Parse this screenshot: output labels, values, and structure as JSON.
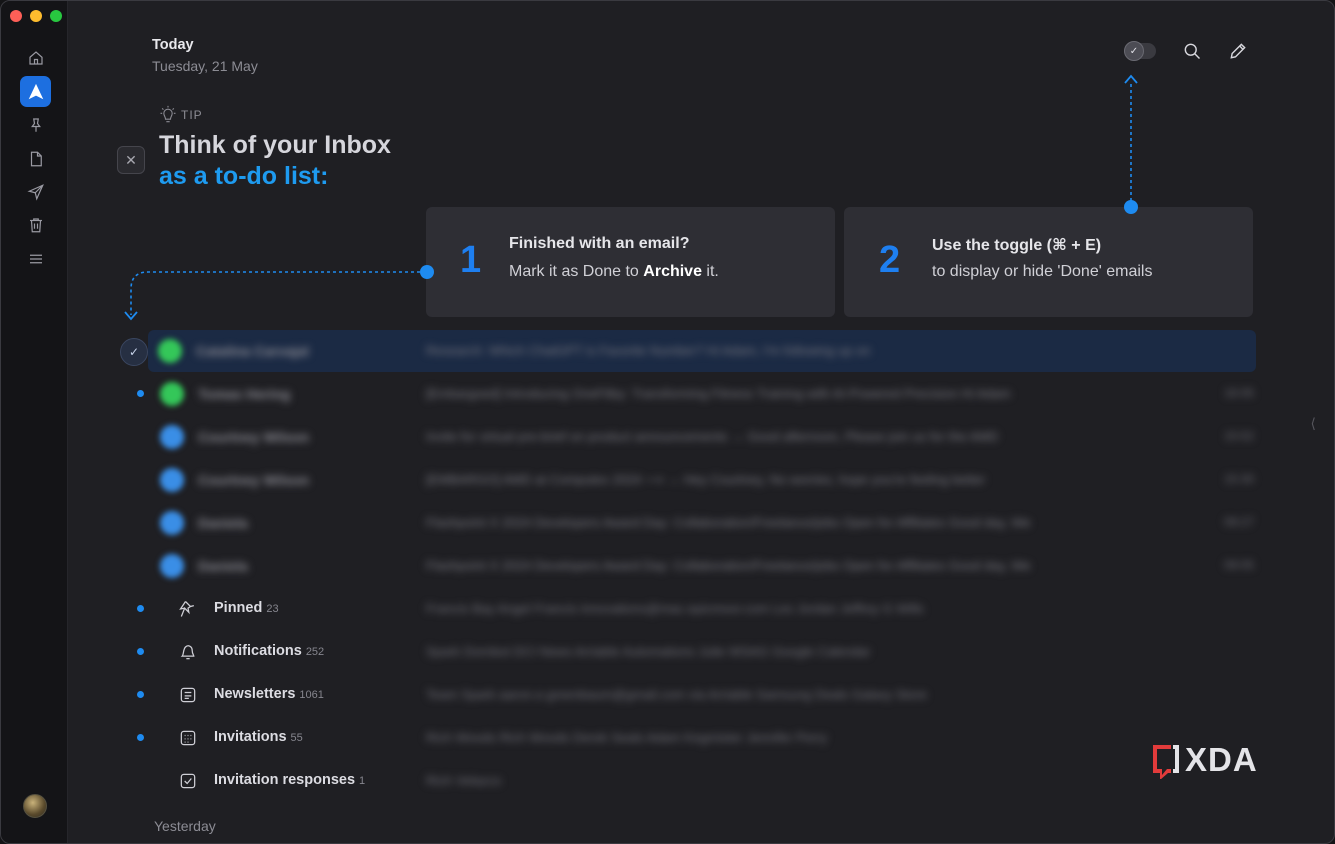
{
  "header": {
    "title": "Today",
    "date": "Tuesday, 21 May"
  },
  "toolbar": {
    "toggle_checkmark": "✓",
    "search_icon": "search-icon",
    "compose_icon": "pencil-icon"
  },
  "tip": {
    "label": "TIP",
    "title_line1": "Think of your Inbox",
    "title_line2": "as a to-do list:",
    "close_symbol": "✕"
  },
  "cards": [
    {
      "number": "1",
      "heading": "Finished with an email?",
      "body_prefix": "Mark it as Done to ",
      "body_bold": "Archive",
      "body_suffix": " it."
    },
    {
      "number": "2",
      "heading": "Use the toggle (⌘ + E)",
      "body": "to display or hide 'Done' emails"
    }
  ],
  "emails": [
    {
      "sender": "Catalina Carvajal",
      "subject": "Research: Which ChatGPT is Favorite Number?  Hi Adam, I'm following up on",
      "time": "",
      "color": "#34c759",
      "unread": false,
      "selected": true
    },
    {
      "sender": "Tomas Hering",
      "subject": "[Embargoed] Introducing OneFitby: Transforming Fitness Training with AI-Powered Precision  Hi Adam",
      "time": "16:05",
      "color": "#34c759",
      "unread": true,
      "selected": false
    },
    {
      "sender": "Courtney Wilson",
      "subject": "Invite for virtual pre-brief on product announcements  →  Good afternoon, Please join us for the AMD",
      "time": "15:52",
      "color": "#3a8ee6",
      "unread": false,
      "selected": false
    },
    {
      "sender": "Courtney Wilson",
      "subject": "[EMBARGO] AMD at Computex 2024  ⟶  →  Hey Courtney, No worries, hope you're feeling better",
      "time": "15:30",
      "color": "#3a8ee6",
      "unread": false,
      "selected": false
    },
    {
      "sender": "Daniela",
      "subject": "Flashpoint X 2024 Developers Award Day: Collaboration/Freelance/jobs Open for Affiliates  Good day, We",
      "time": "09:27",
      "color": "#3a8ee6",
      "unread": false,
      "selected": false
    },
    {
      "sender": "Daniela",
      "subject": "Flashpoint X 2024 Developers Award Day: Collaboration/Freelance/jobs Open for Affiliates  Good day, We",
      "time": "09:05",
      "color": "#3a8ee6",
      "unread": false,
      "selected": false
    }
  ],
  "categories": [
    {
      "label": "Pinned",
      "count": "23",
      "icon": "pin-icon",
      "preview": "Francis Bay   Angel Francis   innovations@mac.epicmoor.com   Les Jordan   Jeffrey G Wills",
      "unread": true
    },
    {
      "label": "Notifications",
      "count": "252",
      "icon": "bell-icon",
      "preview": "Spark   Dornbot   DCI News   Arriable Automations   Julie WSAG   Google Calendar",
      "unread": true
    },
    {
      "label": "Newsletters",
      "count": "1061",
      "icon": "newspaper-icon",
      "preview": "Team Spark   aaron.e.greenbaum@gmail.com via Arriable   Samsung Deals   Galaxy Store",
      "unread": true
    },
    {
      "label": "Invitations",
      "count": "55",
      "icon": "calendar-icon",
      "preview": "Rich Woods   Rich Woods   Derek Seals   Adam Kegmister   Jennifer Perry",
      "unread": true
    },
    {
      "label": "Invitation responses",
      "count": "1",
      "icon": "calendar-check-icon",
      "preview": "Rich Velazco",
      "unread": false
    }
  ],
  "section_yesterday": "Yesterday",
  "watermark": {
    "text": "XDA",
    "accent": "#e23b3b"
  },
  "colors": {
    "accent_blue": "#1e8bf0",
    "tip_blue": "#1e9bf0",
    "background": "#1f1f23"
  }
}
